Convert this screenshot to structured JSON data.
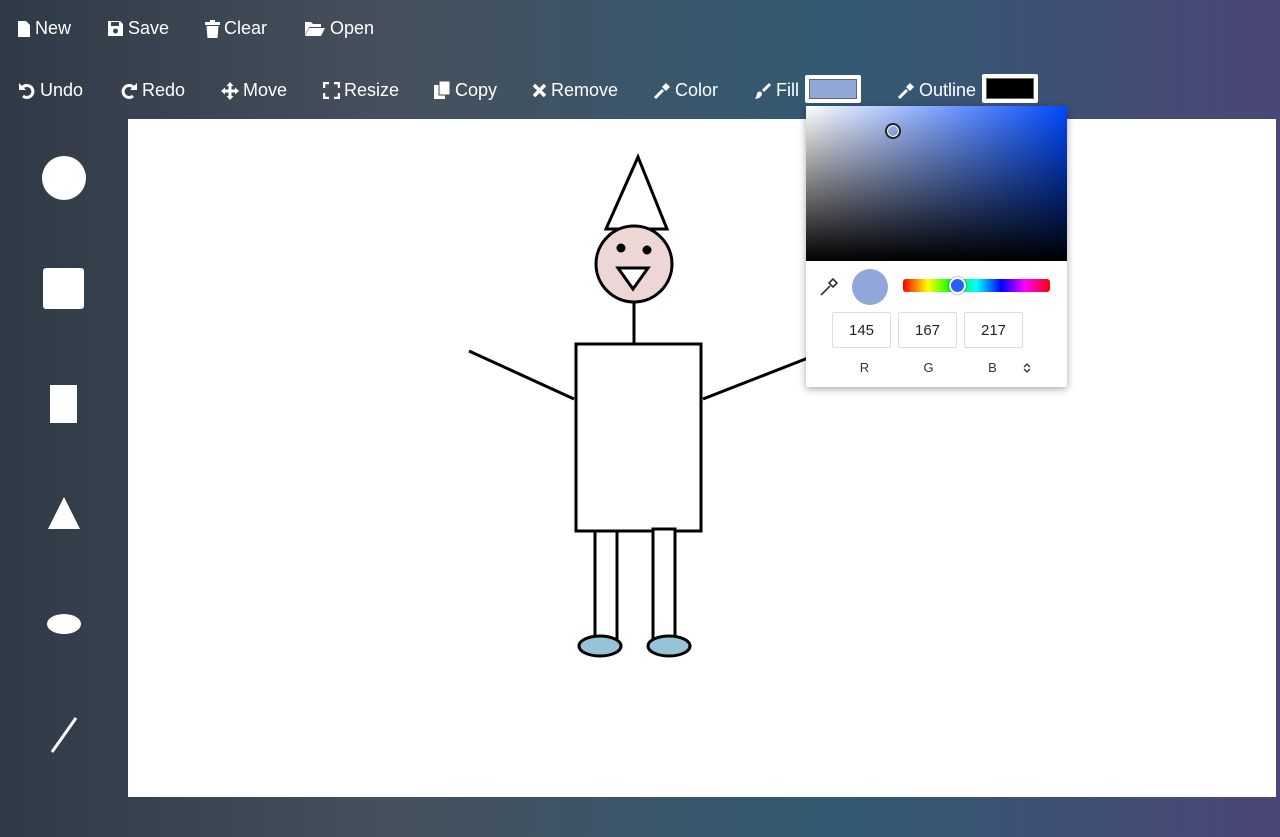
{
  "toolbar_top": {
    "new_label": "New",
    "save_label": "Save",
    "clear_label": "Clear",
    "open_label": "Open"
  },
  "toolbar_edit": {
    "undo_label": "Undo",
    "redo_label": "Redo",
    "move_label": "Move",
    "resize_label": "Resize",
    "copy_label": "Copy",
    "remove_label": "Remove",
    "color_label": "Color",
    "fill_label": "Fill",
    "outline_label": "Outline",
    "fill_color": "#91a7d9",
    "outline_color": "#000000"
  },
  "sidebar": {
    "tools": [
      "circle-tool",
      "square-tool",
      "rectangle-tool",
      "triangle-tool",
      "ellipse-tool",
      "line-tool"
    ]
  },
  "color_picker": {
    "r": "145",
    "g": "167",
    "b": "217",
    "r_label": "R",
    "g_label": "G",
    "b_label": "B",
    "current_color": "#91a7d9",
    "hue_color": "#0049ff"
  },
  "drawing": {
    "face_fill": "#ecd7d5",
    "feet_fill": "#95c4d9",
    "stroke": "#000000"
  }
}
